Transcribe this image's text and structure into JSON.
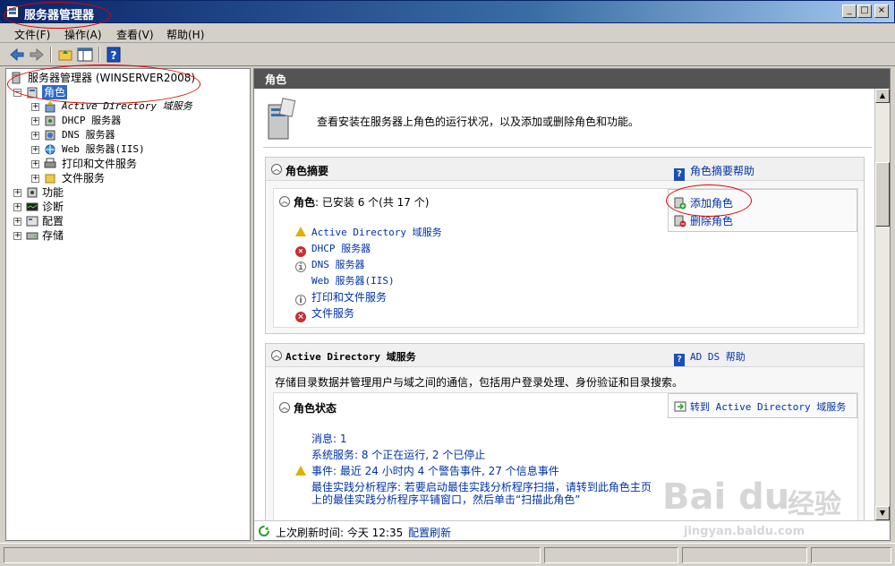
{
  "window": {
    "title": "服务器管理器"
  },
  "menu": [
    "文件(F)",
    "操作(A)",
    "查看(V)",
    "帮助(H)"
  ],
  "toolbar": {
    "icons": [
      "back-icon",
      "forward-icon",
      "up-folder-icon",
      "show-hide-console-tree-icon",
      "help-icon"
    ]
  },
  "tree": {
    "root": "服务器管理器 (WINSERVER2008)",
    "roles": "角色",
    "role_children": [
      "Active Directory 域服务",
      "DHCP 服务器",
      "DNS 服务器",
      "Web 服务器(IIS)",
      "打印和文件服务",
      "文件服务"
    ],
    "others": [
      "功能",
      "诊断",
      "配置",
      "存储"
    ]
  },
  "right": {
    "header": "角色",
    "intro": "查看安装在服务器上角色的运行状况，以及添加或删除角色和功能。",
    "summary": {
      "title": "角色摘要",
      "help": "角色摘要帮助",
      "roles_label": "角色",
      "roles_status": ": 已安装 6 个(共 17 个)",
      "add_role": "添加角色",
      "remove_role": "删除角色",
      "items": [
        {
          "status": "warning",
          "label": "Active Directory 域服务"
        },
        {
          "status": "error",
          "label": "DHCP 服务器"
        },
        {
          "status": "info",
          "label": "DNS 服务器"
        },
        {
          "status": "none",
          "label": "Web 服务器(IIS)"
        },
        {
          "status": "info",
          "label": "打印和文件服务"
        },
        {
          "status": "error",
          "label": "文件服务"
        }
      ]
    },
    "adds": {
      "title": "Active Directory 域服务",
      "help": "AD DS 帮助",
      "description": "存储目录数据并管理用户与域之间的通信，包括用户登录处理、身份验证和目录搜索。",
      "status_title": "角色状态",
      "goto": "转到 Active Directory 域服务",
      "messages": "消息: 1",
      "services": "系统服务: 8 个正在运行, 2 个已停止",
      "events": "事件: 最近 24 小时内 4 个警告事件, 27 个信息事件",
      "bpa_line1": "最佳实践分析程序: 若要启动最佳实践分析程序扫描，请转到此角色主页",
      "bpa_line2": "上的最佳实践分析程序平铺窗口，然后单击“扫描此角色”"
    },
    "refresh": {
      "label": "上次刷新时间: 今天 12:35",
      "link": "配置刷新"
    }
  },
  "watermark": {
    "brand": "Bai du",
    "sub": "经验",
    "url": "jingyan.baidu.com"
  },
  "colors": {
    "title_bar": "#0a246a",
    "link": "#0033aa",
    "selected": "#316ac5",
    "annotation": "#e00000"
  }
}
